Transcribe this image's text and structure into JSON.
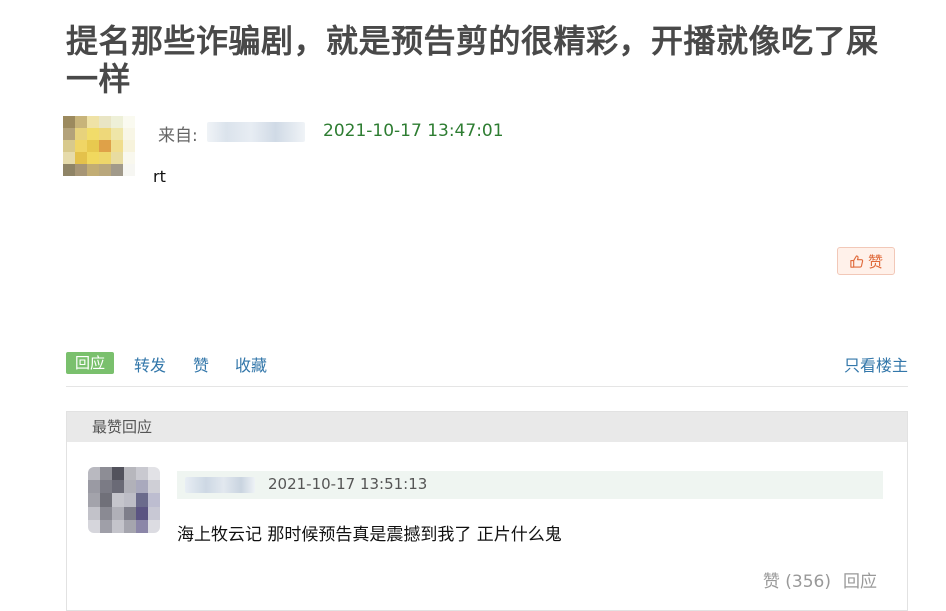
{
  "post": {
    "title": "提名那些诈骗剧，就是预告剪的很精彩，开播就像吃了屎一样",
    "from_label": "来自:",
    "time": "2021-10-17 13:47:01",
    "body": "rt",
    "like_label": "赞"
  },
  "actions": {
    "reply": "回应",
    "share": "转发",
    "like": "赞",
    "collect": "收藏",
    "op_only": "只看楼主"
  },
  "best_replies": {
    "header": "最赞回应",
    "items": [
      {
        "time": "2021-10-17 13:51:13",
        "text": "海上牧云记 那时候预告真是震撼到我了 正片什么鬼",
        "like_label": "赞 (356)",
        "reply_label": "回应"
      }
    ]
  },
  "colors": {
    "title": "#494949",
    "time_green": "#2e7d32",
    "link_blue": "#3377aa",
    "reply_btn_bg": "#7ac06d",
    "like_accent": "#e06a3b"
  }
}
